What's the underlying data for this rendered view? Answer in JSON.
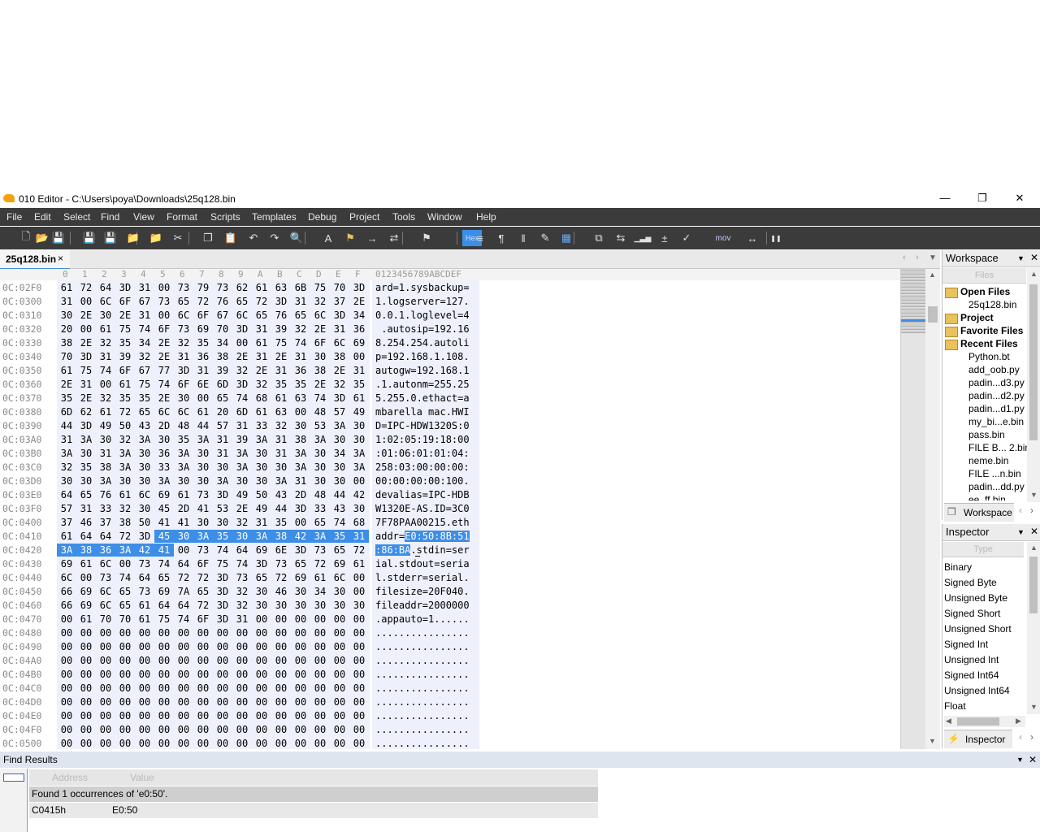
{
  "app": {
    "title": "010 Editor - C:\\Users\\poya\\Downloads\\25q128.bin",
    "window_controls": [
      "minimize-icon",
      "restore-icon",
      "close-icon"
    ]
  },
  "menu": [
    "File",
    "Edit",
    "Select",
    "Find",
    "View",
    "Format",
    "Scripts",
    "Templates",
    "Debug",
    "Project",
    "Tools",
    "Window",
    "Help"
  ],
  "toolbar": {
    "mov_label": "mov",
    "hex_label": "Hex",
    "icons": [
      "new-file-icon",
      "open-icon",
      "save-icon",
      "save-as-icon",
      "save-all-icon",
      "open-folder-icon",
      "close-folder-icon",
      "cut-icon",
      "copy-icon",
      "paste-icon",
      "undo-icon",
      "redo-icon",
      "find-icon",
      "replace-icon",
      "find-in-files-icon",
      "goto-icon",
      "compare-icon",
      "bookmark-icon",
      "hex-icon",
      "text-format-icon",
      "paragraph-icon",
      "columns-icon",
      "highlight-icon",
      "calculator-icon",
      "templates-icon",
      "swap-icon",
      "histogram-icon",
      "add-icon",
      "check-icon",
      "base-convert-icon",
      "pause-icon"
    ]
  },
  "tab": {
    "label": "25q128.bin",
    "close": "×"
  },
  "hex": {
    "column_header": [
      "0",
      "1",
      "2",
      "3",
      "4",
      "5",
      "6",
      "7",
      "8",
      "9",
      "A",
      "B",
      "C",
      "D",
      "E",
      "F"
    ],
    "ascii_header": "0123456789ABCDEF",
    "rows": [
      {
        "addr": "0C:02F0",
        "bytes": "61 72 64 3D 31 00 73 79 73 62 61 63 6B 75 70 3D",
        "ascii": "ard=1.sysbackup="
      },
      {
        "addr": "0C:0300",
        "bytes": "31 00 6C 6F 67 73 65 72 76 65 72 3D 31 32 37 2E",
        "ascii": "1.logserver=127."
      },
      {
        "addr": "0C:0310",
        "bytes": "30 2E 30 2E 31 00 6C 6F 67 6C 65 76 65 6C 3D 34",
        "ascii": "0.0.1.loglevel=4"
      },
      {
        "addr": "0C:0320",
        "bytes": "20 00 61 75 74 6F 73 69 70 3D 31 39 32 2E 31 36",
        "ascii": " .autosip=192.16"
      },
      {
        "addr": "0C:0330",
        "bytes": "38 2E 32 35 34 2E 32 35 34 00 61 75 74 6F 6C 69",
        "ascii": "8.254.254.autoli"
      },
      {
        "addr": "0C:0340",
        "bytes": "70 3D 31 39 32 2E 31 36 38 2E 31 2E 31 30 38 00",
        "ascii": "p=192.168.1.108."
      },
      {
        "addr": "0C:0350",
        "bytes": "61 75 74 6F 67 77 3D 31 39 32 2E 31 36 38 2E 31",
        "ascii": "autogw=192.168.1"
      },
      {
        "addr": "0C:0360",
        "bytes": "2E 31 00 61 75 74 6F 6E 6D 3D 32 35 35 2E 32 35",
        "ascii": ".1.autonm=255.25"
      },
      {
        "addr": "0C:0370",
        "bytes": "35 2E 32 35 35 2E 30 00 65 74 68 61 63 74 3D 61",
        "ascii": "5.255.0.ethact=a"
      },
      {
        "addr": "0C:0380",
        "bytes": "6D 62 61 72 65 6C 6C 61 20 6D 61 63 00 48 57 49",
        "ascii": "mbarella mac.HWI"
      },
      {
        "addr": "0C:0390",
        "bytes": "44 3D 49 50 43 2D 48 44 57 31 33 32 30 53 3A 30",
        "ascii": "D=IPC-HDW1320S:0"
      },
      {
        "addr": "0C:03A0",
        "bytes": "31 3A 30 32 3A 30 35 3A 31 39 3A 31 38 3A 30 30",
        "ascii": "1:02:05:19:18:00"
      },
      {
        "addr": "0C:03B0",
        "bytes": "3A 30 31 3A 30 36 3A 30 31 3A 30 31 3A 30 34 3A",
        "ascii": ":01:06:01:01:04:"
      },
      {
        "addr": "0C:03C0",
        "bytes": "32 35 38 3A 30 33 3A 30 30 3A 30 30 3A 30 30 3A",
        "ascii": "258:03:00:00:00:"
      },
      {
        "addr": "0C:03D0",
        "bytes": "30 30 3A 30 30 3A 30 30 3A 30 30 3A 31 30 30 00",
        "ascii": "00:00:00:00:100."
      },
      {
        "addr": "0C:03E0",
        "bytes": "64 65 76 61 6C 69 61 73 3D 49 50 43 2D 48 44 42",
        "ascii": "devalias=IPC-HDB"
      },
      {
        "addr": "0C:03F0",
        "bytes": "57 31 33 32 30 45 2D 41 53 2E 49 44 3D 33 43 30",
        "ascii": "W1320E-AS.ID=3C0"
      },
      {
        "addr": "0C:0400",
        "bytes": "37 46 37 38 50 41 41 30 30 32 31 35 00 65 74 68",
        "ascii": "7F78PAA00215.eth"
      },
      {
        "addr": "0C:0410",
        "bytes": "61 64 64 72 3D 45 30 3A 35 30 3A 38 42 3A 35 31",
        "ascii": "addr=E0:50:8B:51",
        "sel_from": 5,
        "sel_to": 15
      },
      {
        "addr": "0C:0420",
        "bytes": "3A 38 36 3A 42 41 00 73 74 64 69 6E 3D 73 65 72",
        "ascii": ":86:BA.stdin=ser",
        "sel_from": 0,
        "sel_to": 5
      },
      {
        "addr": "0C:0430",
        "bytes": "69 61 6C 00 73 74 64 6F 75 74 3D 73 65 72 69 61",
        "ascii": "ial.stdout=seria"
      },
      {
        "addr": "0C:0440",
        "bytes": "6C 00 73 74 64 65 72 72 3D 73 65 72 69 61 6C 00",
        "ascii": "l.stderr=serial."
      },
      {
        "addr": "0C:0450",
        "bytes": "66 69 6C 65 73 69 7A 65 3D 32 30 46 30 34 30 00",
        "ascii": "filesize=20F040."
      },
      {
        "addr": "0C:0460",
        "bytes": "66 69 6C 65 61 64 64 72 3D 32 30 30 30 30 30 30",
        "ascii": "fileaddr=2000000"
      },
      {
        "addr": "0C:0470",
        "bytes": "00 61 70 70 61 75 74 6F 3D 31 00 00 00 00 00 00",
        "ascii": ".appauto=1......"
      },
      {
        "addr": "0C:0480",
        "bytes": "00 00 00 00 00 00 00 00 00 00 00 00 00 00 00 00",
        "ascii": "................"
      },
      {
        "addr": "0C:0490",
        "bytes": "00 00 00 00 00 00 00 00 00 00 00 00 00 00 00 00",
        "ascii": "................"
      },
      {
        "addr": "0C:04A0",
        "bytes": "00 00 00 00 00 00 00 00 00 00 00 00 00 00 00 00",
        "ascii": "................"
      },
      {
        "addr": "0C:04B0",
        "bytes": "00 00 00 00 00 00 00 00 00 00 00 00 00 00 00 00",
        "ascii": "................"
      },
      {
        "addr": "0C:04C0",
        "bytes": "00 00 00 00 00 00 00 00 00 00 00 00 00 00 00 00",
        "ascii": "................"
      },
      {
        "addr": "0C:04D0",
        "bytes": "00 00 00 00 00 00 00 00 00 00 00 00 00 00 00 00",
        "ascii": "................"
      },
      {
        "addr": "0C:04E0",
        "bytes": "00 00 00 00 00 00 00 00 00 00 00 00 00 00 00 00",
        "ascii": "................"
      },
      {
        "addr": "0C:04F0",
        "bytes": "00 00 00 00 00 00 00 00 00 00 00 00 00 00 00 00",
        "ascii": "................"
      },
      {
        "addr": "0C:0500",
        "bytes": "00 00 00 00 00 00 00 00 00 00 00 00 00 00 00 00",
        "ascii": "................"
      }
    ]
  },
  "workspace": {
    "title": "Workspace",
    "files_header": "Files",
    "tab_label": "Workspace",
    "items": [
      {
        "label": "Open Files",
        "bold": true,
        "folder": true
      },
      {
        "label": "25q128.bin",
        "bold": false,
        "folder": false
      },
      {
        "label": "Project",
        "bold": true,
        "folder": true
      },
      {
        "label": "Favorite Files",
        "bold": true,
        "folder": true
      },
      {
        "label": "Recent Files",
        "bold": true,
        "folder": true
      },
      {
        "label": "Python.bt",
        "bold": false,
        "folder": false
      },
      {
        "label": "add_oob.py",
        "bold": false,
        "folder": false
      },
      {
        "label": "padin...d3.py",
        "bold": false,
        "folder": false
      },
      {
        "label": "padin...d2.py",
        "bold": false,
        "folder": false
      },
      {
        "label": "padin...d1.py",
        "bold": false,
        "folder": false
      },
      {
        "label": "my_bi...e.bin",
        "bold": false,
        "folder": false
      },
      {
        "label": "pass.bin",
        "bold": false,
        "folder": false
      },
      {
        "label": "FILE B... 2.bin",
        "bold": false,
        "folder": false
      },
      {
        "label": "neme.bin",
        "bold": false,
        "folder": false
      },
      {
        "label": "FILE ...n.bin",
        "bold": false,
        "folder": false
      },
      {
        "label": "padin...dd.py",
        "bold": false,
        "folder": false
      },
      {
        "label": "ee_ff.bin",
        "bold": false,
        "folder": false
      }
    ]
  },
  "inspector": {
    "title": "Inspector",
    "type_header": "Type",
    "tab_label": "Inspector",
    "items": [
      "Binary",
      "Signed Byte",
      "Unsigned Byte",
      "Signed Short",
      "Unsigned Short",
      "Signed Int",
      "Unsigned Int",
      "Signed Int64",
      "Unsigned Int64",
      "Float"
    ]
  },
  "find_results": {
    "title": "Find Results",
    "col_address": "Address",
    "col_value": "Value",
    "summary": "Found 1 occurrences of 'e0:50'.",
    "results": [
      {
        "address": "C0415h",
        "value": "E0:50"
      }
    ]
  },
  "colors": {
    "selection": "#3d8ee6",
    "menubar": "#3b3b3b",
    "column_bg": "#eef0fb"
  }
}
